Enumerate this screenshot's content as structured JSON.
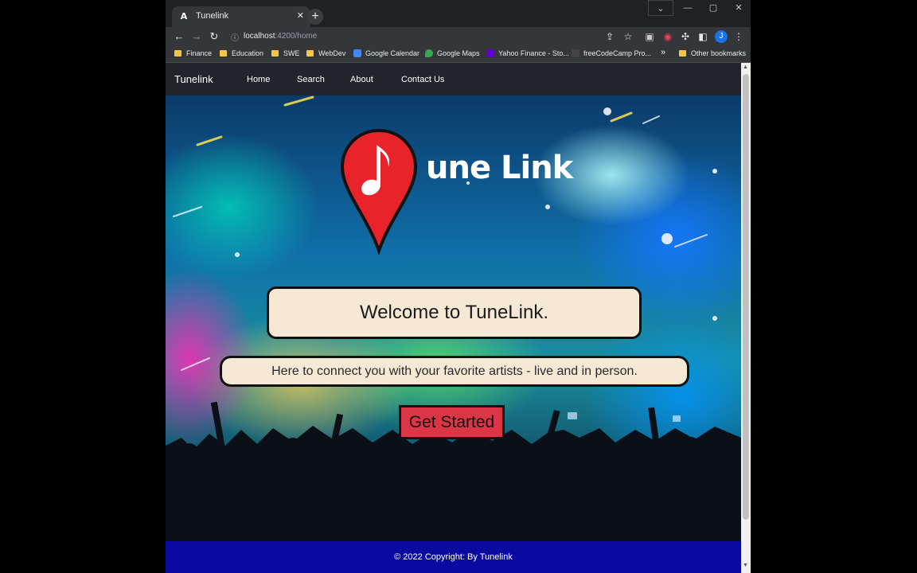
{
  "browser": {
    "tab": {
      "favicon": "A",
      "title": "Tunelink",
      "close": "✕"
    },
    "new_tab": "+",
    "window_controls": {
      "dropdown": "⌄",
      "minimize": "—",
      "maximize": "▢",
      "close": "✕"
    },
    "toolbar": {
      "back": "←",
      "forward": "→",
      "reload": "↻",
      "info": "ⓘ",
      "url_host": "localhost",
      "url_rest": ":4200/home",
      "share": "⇪",
      "bookmark_star": "☆",
      "ext1": "▣",
      "ext2": "◉",
      "extensions": "✣",
      "sidebar": "◧",
      "avatar": "J",
      "menu": "⋮"
    },
    "bookmarks": [
      {
        "label": "Finance",
        "type": "folder"
      },
      {
        "label": "Education",
        "type": "folder"
      },
      {
        "label": "SWE",
        "type": "folder"
      },
      {
        "label": "WebDev",
        "type": "folder"
      },
      {
        "label": "Google Calendar",
        "type": "calendar"
      },
      {
        "label": "Google Maps",
        "type": "maps"
      },
      {
        "label": "Yahoo Finance - Sto...",
        "type": "yahoo"
      },
      {
        "label": "freeCodeCamp Pro...",
        "type": "fcc"
      }
    ],
    "bookmarks_more": "»",
    "other_bookmarks": "Other bookmarks"
  },
  "app": {
    "brand": "Tunelink",
    "nav": [
      "Home",
      "Search",
      "About",
      "Contact Us"
    ],
    "logo_text": "une Link",
    "welcome": "Welcome to TuneLink.",
    "subtitle": "Here to connect you with your favorite artists - live and in person.",
    "cta": "Get Started",
    "footer": "© 2022 Copyright: By Tunelink"
  },
  "colors": {
    "nav_bg": "#212529",
    "cta_bg": "#dc3545",
    "footer_bg": "#0a0aa0",
    "pin_red": "#e8232a",
    "box_bg": "#f5e8d5"
  }
}
